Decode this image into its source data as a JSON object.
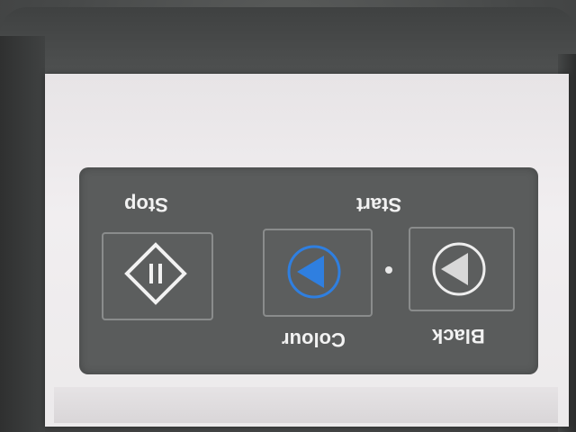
{
  "panel": {
    "stop_label": "Stop",
    "start_label": "Start",
    "colour_label": "Colour",
    "black_label": "Black"
  },
  "icons": {
    "stop": "pause-diamond-icon",
    "colour_start": "play-colour-icon",
    "black_start": "play-black-icon"
  },
  "colors": {
    "colour_accent": "#2f7fe0",
    "panel": "#5a5c5c",
    "card": "#eeebed"
  }
}
